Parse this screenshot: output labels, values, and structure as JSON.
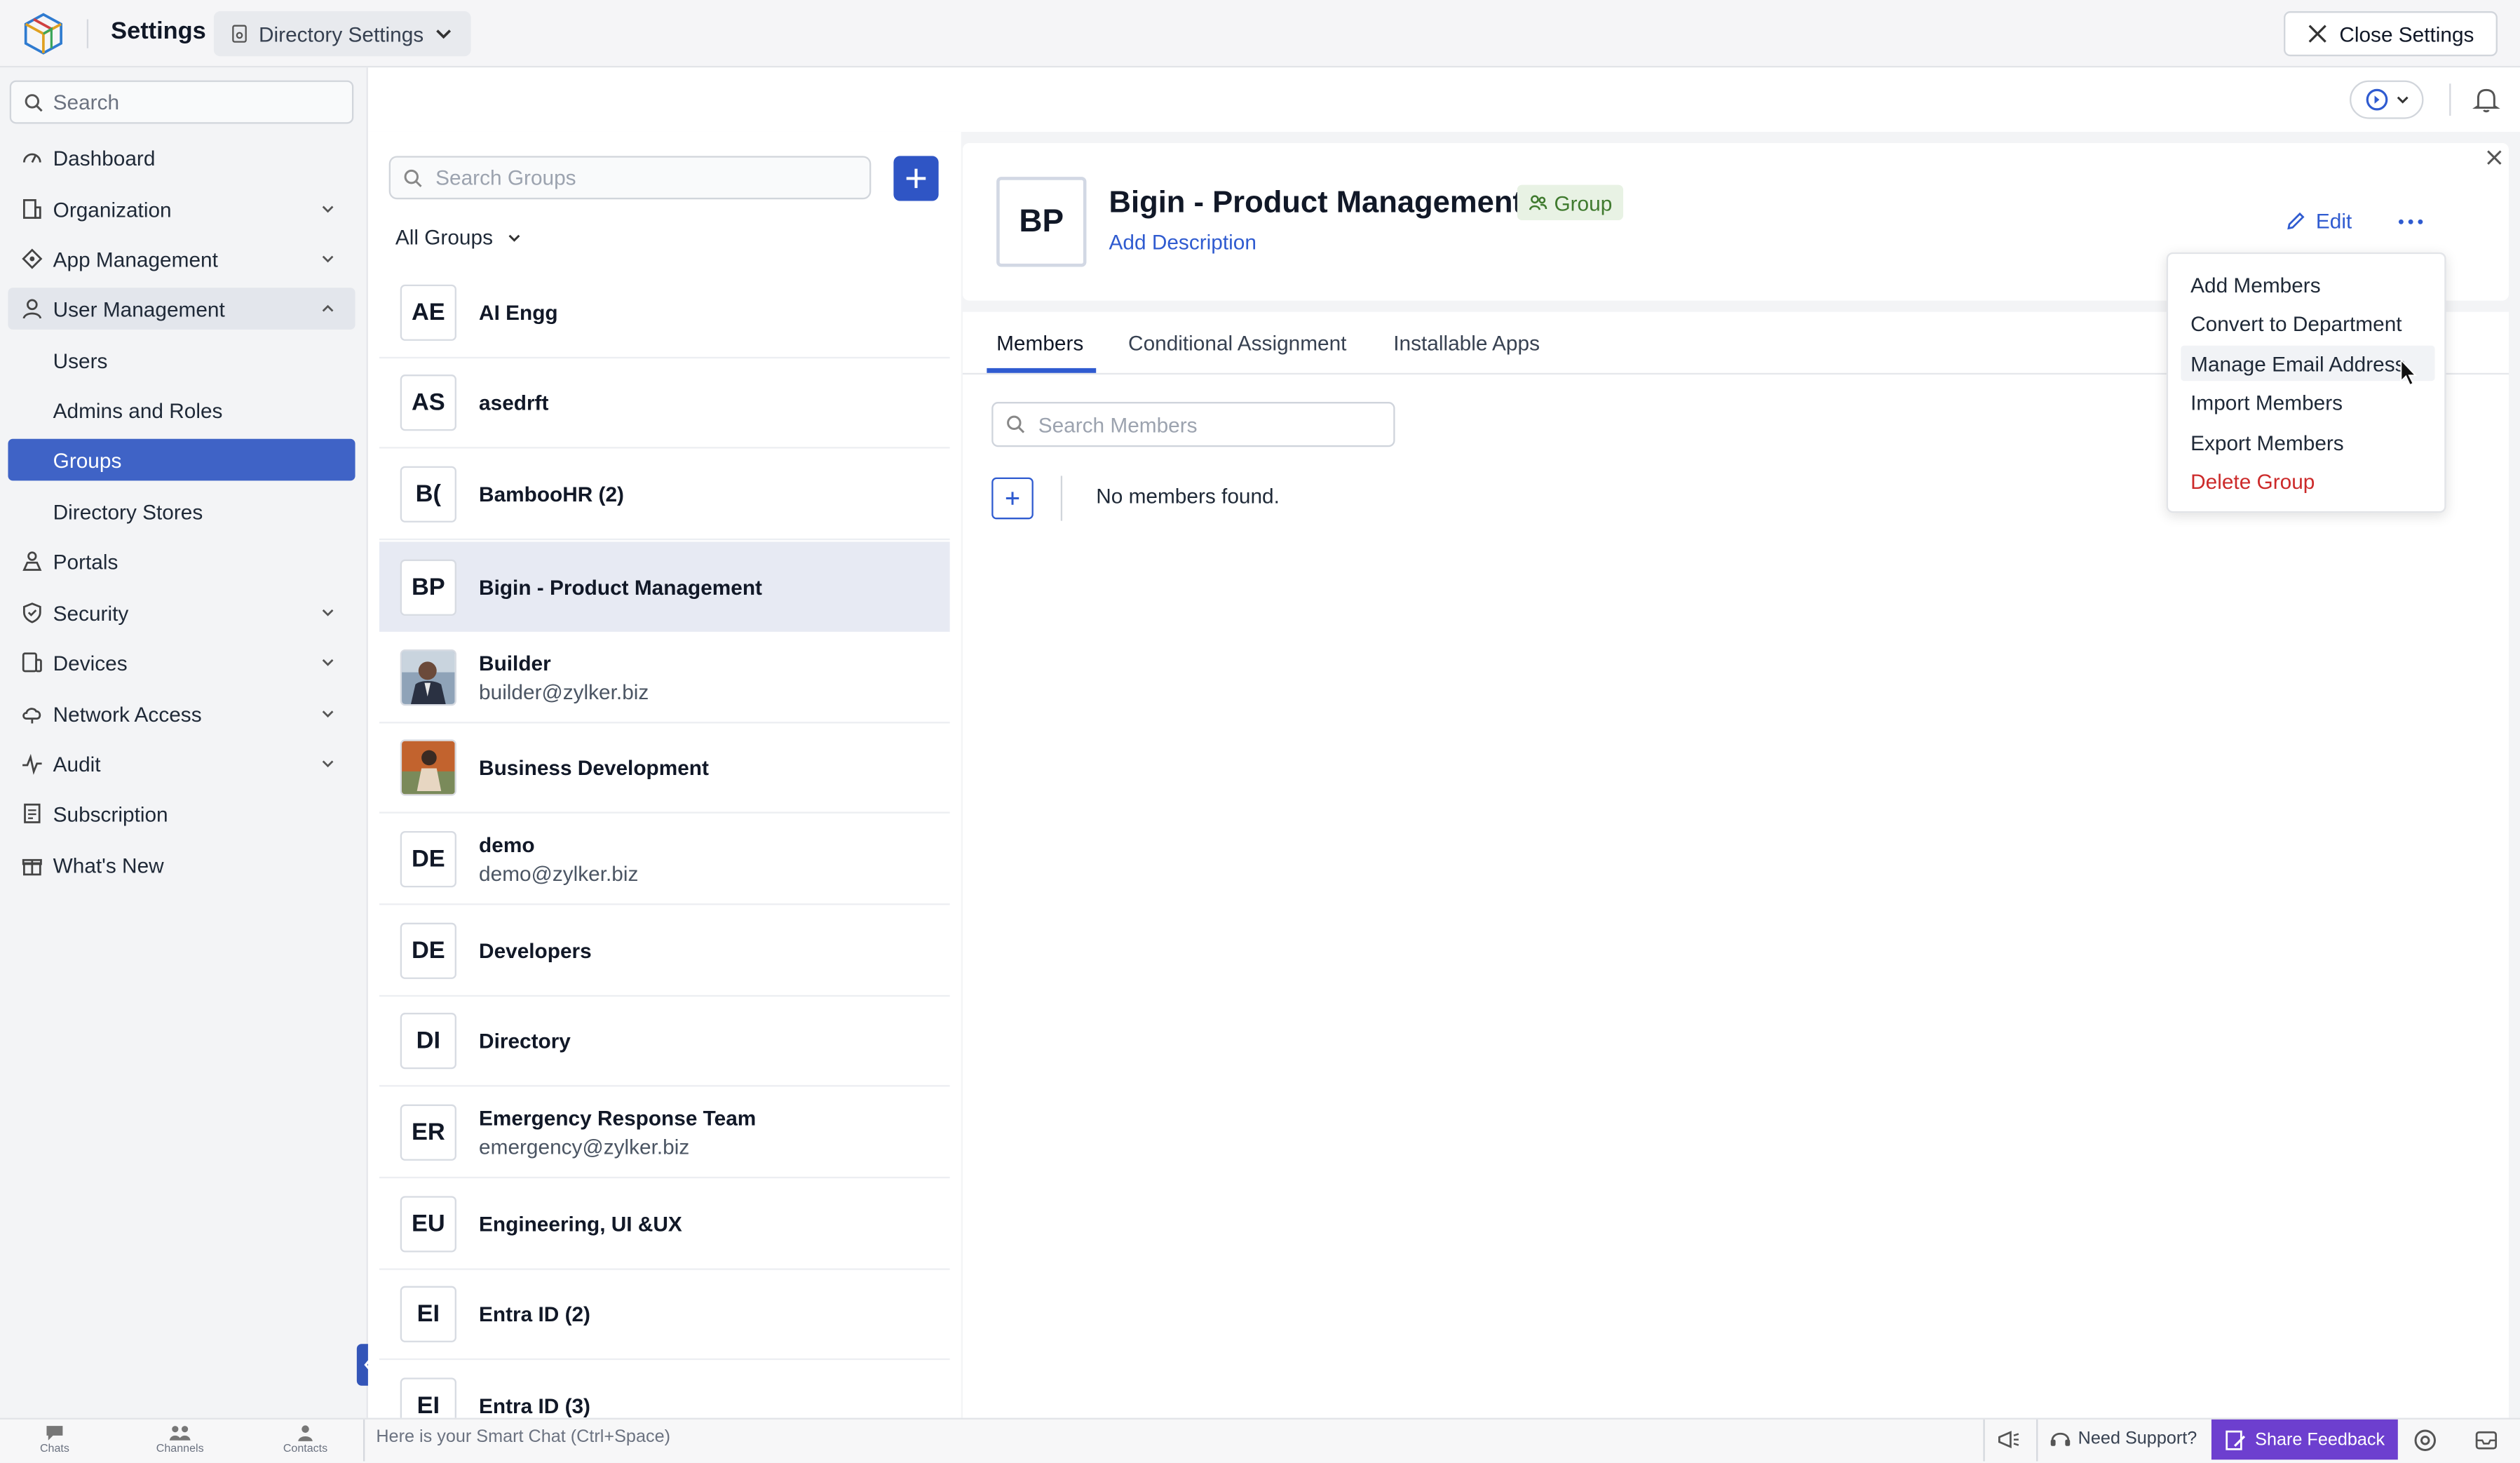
{
  "app": {
    "title": "Settings",
    "directory_selector": "Directory Settings",
    "close_label": "Close Settings"
  },
  "sidebar": {
    "search_placeholder": "Search",
    "items": [
      {
        "label": "Dashboard",
        "icon": "dashboard-icon"
      },
      {
        "label": "Organization",
        "icon": "building-icon"
      },
      {
        "label": "App Management",
        "icon": "apps-icon"
      },
      {
        "label": "User Management",
        "icon": "user-icon"
      },
      {
        "label": "Users"
      },
      {
        "label": "Admins and Roles"
      },
      {
        "label": "Groups"
      },
      {
        "label": "Directory Stores"
      },
      {
        "label": "Portals",
        "icon": "portal-icon"
      },
      {
        "label": "Security",
        "icon": "shield-icon"
      },
      {
        "label": "Devices",
        "icon": "devices-icon"
      },
      {
        "label": "Network Access",
        "icon": "cloud-icon"
      },
      {
        "label": "Audit",
        "icon": "activity-icon"
      },
      {
        "label": "Subscription",
        "icon": "receipt-icon"
      },
      {
        "label": "What's New",
        "icon": "gift-icon"
      }
    ]
  },
  "groups": {
    "search_placeholder": "Search Groups",
    "filter_label": "All Groups",
    "list": [
      {
        "initials": "AE",
        "name": "AI Engg",
        "email": ""
      },
      {
        "initials": "AS",
        "name": "asedrft",
        "email": ""
      },
      {
        "initials": "B(",
        "name": "BambooHR (2)",
        "email": ""
      },
      {
        "initials": "BP",
        "name": "Bigin - Product Management",
        "email": ""
      },
      {
        "initials": "",
        "name": "Builder",
        "email": "builder@zylker.biz"
      },
      {
        "initials": "",
        "name": "Business Development",
        "email": ""
      },
      {
        "initials": "DE",
        "name": "demo",
        "email": "demo@zylker.biz"
      },
      {
        "initials": "DE",
        "name": "Developers",
        "email": ""
      },
      {
        "initials": "DI",
        "name": "Directory",
        "email": ""
      },
      {
        "initials": "ER",
        "name": "Emergency Response Team",
        "email": "emergency@zylker.biz"
      },
      {
        "initials": "EU",
        "name": "Engineering, UI &UX",
        "email": ""
      },
      {
        "initials": "EI",
        "name": "Entra ID (2)",
        "email": ""
      },
      {
        "initials": "EI",
        "name": "Entra ID (3)",
        "email": ""
      }
    ]
  },
  "detail": {
    "initials": "BP",
    "name": "Bigin - Product Management",
    "badge": "Group",
    "add_description": "Add Description",
    "edit_label": "Edit",
    "tabs": [
      "Members",
      "Conditional Assignment",
      "Installable Apps"
    ],
    "members_search_placeholder": "Search Members",
    "empty_text": "No members found."
  },
  "menu": {
    "items": [
      "Add Members",
      "Convert to Department",
      "Manage Email Address",
      "Import Members",
      "Export Members",
      "Delete Group"
    ]
  },
  "bottom": {
    "chats": "Chats",
    "channels": "Channels",
    "contacts": "Contacts",
    "smart_chat_placeholder": "Here is your Smart Chat (Ctrl+Space)",
    "support": "Need Support?",
    "feedback": "Share Feedback"
  },
  "colors": {
    "accent": "#2f5bd0",
    "selected_nav": "#3f63c6",
    "danger": "#cc2a2a",
    "feedback": "#6d3fcf"
  }
}
